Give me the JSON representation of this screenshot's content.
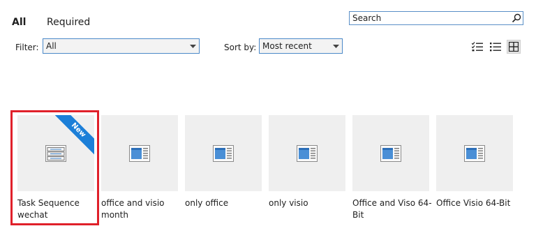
{
  "tabs": [
    {
      "label": "All"
    },
    {
      "label": "Required"
    }
  ],
  "search": {
    "placeholder": "Search"
  },
  "filter": {
    "label": "Filter:",
    "value": "All"
  },
  "sort": {
    "label": "Sort by:",
    "value": "Most recent"
  },
  "view_modes": [
    "checklist-view-icon",
    "list-view-icon",
    "tile-view-icon"
  ],
  "colors": {
    "accent": "#1c7fd8",
    "highlight": "#e0202a",
    "border": "#4a88c8"
  },
  "items": [
    {
      "title": "Task Sequence wechat",
      "badge": "New",
      "icon": "task-sequence-icon"
    },
    {
      "title": "office and visio month",
      "icon": "application-icon"
    },
    {
      "title": "only office",
      "icon": "application-icon"
    },
    {
      "title": "only visio",
      "icon": "application-icon"
    },
    {
      "title": "Office and Viso 64-Bit",
      "icon": "application-icon"
    },
    {
      "title": "Office Visio 64-Bit",
      "icon": "application-icon"
    }
  ]
}
